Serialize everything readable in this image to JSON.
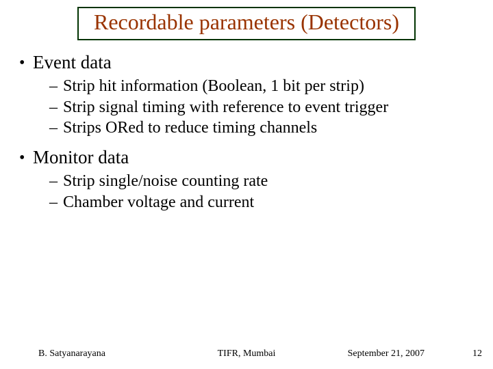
{
  "title": "Recordable parameters (Detectors)",
  "bullets": [
    {
      "label": "Event data",
      "children": [
        "Strip hit information (Boolean, 1 bit per strip)",
        "Strip signal timing with reference to  event trigger",
        "Strips ORed to reduce timing channels"
      ]
    },
    {
      "label": "Monitor data",
      "children": [
        "Strip single/noise counting rate",
        "Chamber voltage and current"
      ]
    }
  ],
  "footer": {
    "author": "B. Satyanarayana",
    "org": "TIFR, Mumbai",
    "date": "September 21, 2007",
    "page": "12"
  }
}
